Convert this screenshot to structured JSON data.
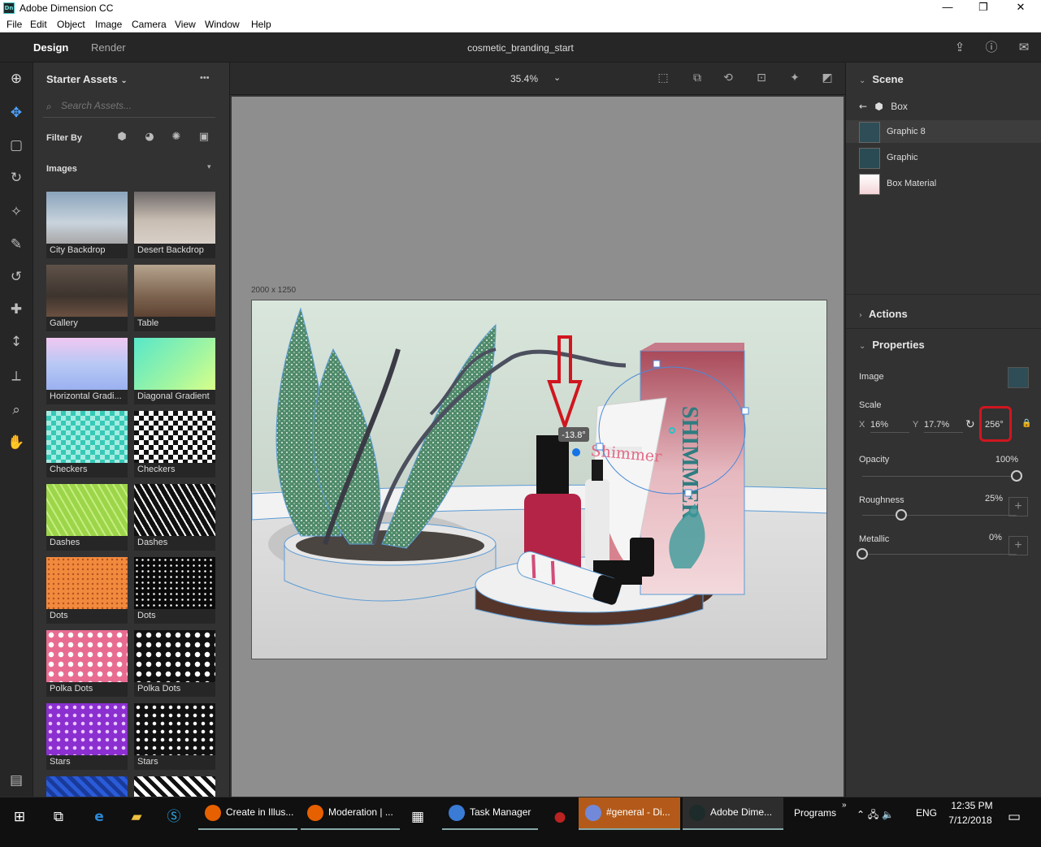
{
  "window": {
    "app_title": "Adobe Dimension CC",
    "app_icon": "Dn",
    "minimize": "—",
    "maximize": "❐",
    "close": "✕"
  },
  "menu": [
    "File",
    "Edit",
    "Object",
    "Image",
    "Camera",
    "View",
    "Window",
    "Help"
  ],
  "tabs": {
    "design": "Design",
    "render": "Render"
  },
  "document_title": "cosmetic_branding_start",
  "toolbar_icons": [
    "add-icon",
    "select-icon",
    "orbit-icon",
    "rotate-icon",
    "magic-wand-icon",
    "eyedropper-icon",
    "lasso-icon",
    "pan-icon",
    "dolly-icon",
    "horizon-icon",
    "zoom-icon",
    "hand-icon"
  ],
  "assets": {
    "header": "Starter Assets",
    "more": "•••",
    "search_placeholder": "Search Assets...",
    "filter_label": "Filter By",
    "section": "Images",
    "items": [
      {
        "label": "City Backdrop",
        "color": "#7e9bb5"
      },
      {
        "label": "Desert Backdrop",
        "color": "#a39a92"
      },
      {
        "label": "Gallery",
        "color": "#6d5e52"
      },
      {
        "label": "Table",
        "color": "#8c7660"
      },
      {
        "label": "Horizontal Gradi...",
        "color": "#d7c7f5"
      },
      {
        "label": "Diagonal Gradient",
        "color": "#6fe7cf"
      },
      {
        "label": "Checkers",
        "color": "#36c9b6"
      },
      {
        "label": "Checkers",
        "color": "#ffffff"
      },
      {
        "label": "Dashes",
        "color": "#9cd54a"
      },
      {
        "label": "Dashes",
        "color": "#111111"
      },
      {
        "label": "Dots",
        "color": "#f28a3e"
      },
      {
        "label": "Dots",
        "color": "#0a0a0a"
      },
      {
        "label": "Polka Dots",
        "color": "#e86c91"
      },
      {
        "label": "Polka Dots",
        "color": "#111111"
      },
      {
        "label": "Stars",
        "color": "#8b2fd0"
      },
      {
        "label": "Stars",
        "color": "#111111"
      }
    ]
  },
  "canvas": {
    "zoom": "35.4%",
    "dimensions": "2000 x 1250",
    "angle_tooltip": "-13.8°",
    "product_text_tube": "Shimmer",
    "product_text_box": "SHIMMER"
  },
  "scene": {
    "header": "Scene",
    "back_item": "Box",
    "layers": [
      "Graphic 8",
      "Graphic",
      "Box Material"
    ]
  },
  "actions": {
    "header": "Actions"
  },
  "properties": {
    "header": "Properties",
    "image_label": "Image",
    "scale_label": "Scale",
    "x_label": "X",
    "x_value": "16%",
    "y_label": "Y",
    "y_value": "17.7%",
    "rotation_value": "256°",
    "opacity_label": "Opacity",
    "opacity_value": "100%",
    "opacity": 1.0,
    "roughness_label": "Roughness",
    "roughness_value": "25%",
    "roughness": 0.25,
    "metallic_label": "Metallic",
    "metallic_value": "0%",
    "metallic": 0.0
  },
  "taskbar": {
    "apps": [
      {
        "label": "Create in Illus...",
        "color": "#e66000"
      },
      {
        "label": "Moderation | ...",
        "color": "#e66000"
      },
      {
        "label": "Task Manager",
        "color": "#3a7bd5"
      },
      {
        "label": "#general - Di...",
        "color": "#7289da"
      },
      {
        "label": "Adobe Dime...",
        "color": "#1d2b2b"
      }
    ],
    "programs": "Programs",
    "language": "ENG",
    "time": "12:35 PM",
    "date": "7/12/2018"
  }
}
